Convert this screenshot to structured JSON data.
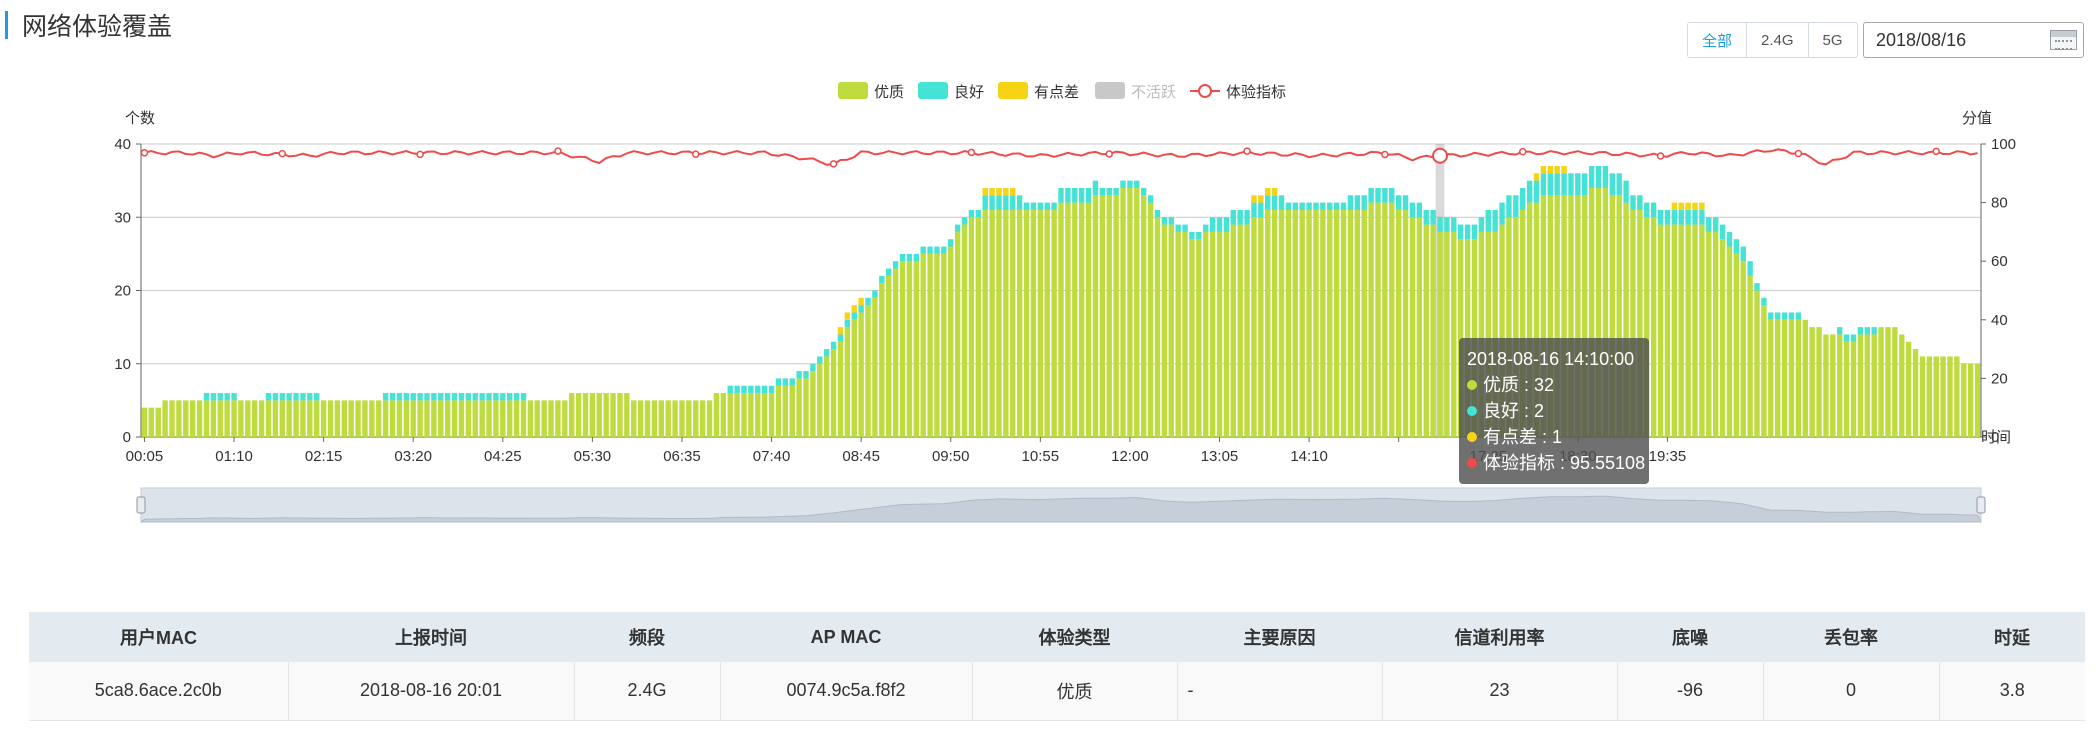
{
  "header": {
    "title": "网络体验覆盖"
  },
  "band_filter": {
    "options": [
      "全部",
      "2.4G",
      "5G"
    ],
    "selected": "全部"
  },
  "date_picker": {
    "value": "2018/08/16"
  },
  "colors": {
    "youzhi": "#bedc3e",
    "lianghao": "#45e2d6",
    "youdiancha": "#f7d316",
    "buhuoyue": "#c8c8c8",
    "tiyan": "#ee4b4b",
    "accent": "#1e9ce0"
  },
  "tooltip": {
    "time": "2018-08-16 14:10:00",
    "rows": [
      {
        "label": "优质 : 32",
        "color": "#bedc3e"
      },
      {
        "label": "良好 : 2",
        "color": "#45e2d6"
      },
      {
        "label": "有点差 : 1",
        "color": "#f7d316"
      },
      {
        "label": "体验指标 : 95.55108",
        "color": "#ee4b4b"
      }
    ]
  },
  "chart_data": {
    "type": "bar",
    "legend": [
      "优质",
      "良好",
      "有点差",
      "不活跃",
      "体验指标"
    ],
    "legend_position": "top-center",
    "y_left": {
      "label": "个数",
      "range": [
        0,
        40
      ],
      "ticks": [
        0,
        10,
        20,
        30,
        40
      ]
    },
    "y_right": {
      "label": "分值",
      "range": [
        0,
        100
      ],
      "ticks": [
        0,
        20,
        40,
        60,
        80,
        100
      ]
    },
    "x_label": "时间",
    "x_tick_labels": [
      "00:05",
      "01:10",
      "02:15",
      "03:20",
      "04:25",
      "05:30",
      "06:35",
      "07:40",
      "08:45",
      "09:50",
      "10:55",
      "12:00",
      "13:05",
      "14:10",
      "",
      "17:25",
      "18:30",
      "19:35"
    ],
    "grid": true,
    "anchors": {
      "youzhi": [
        [
          0,
          4
        ],
        [
          6,
          5
        ],
        [
          40,
          5
        ],
        [
          60,
          5
        ],
        [
          64,
          6
        ],
        [
          76,
          5
        ],
        [
          82,
          5
        ],
        [
          84,
          6
        ],
        [
          90,
          6
        ],
        [
          96,
          8
        ],
        [
          100,
          12
        ],
        [
          104,
          17
        ],
        [
          110,
          24
        ],
        [
          116,
          25
        ],
        [
          120,
          30
        ],
        [
          124,
          31
        ],
        [
          130,
          31
        ],
        [
          136,
          32
        ],
        [
          140,
          33
        ],
        [
          144,
          34
        ],
        [
          148,
          29
        ],
        [
          152,
          27
        ],
        [
          156,
          28
        ],
        [
          160,
          29
        ],
        [
          164,
          31
        ],
        [
          170,
          31
        ],
        [
          176,
          31
        ],
        [
          180,
          32
        ],
        [
          184,
          30
        ],
        [
          188,
          28
        ],
        [
          192,
          27
        ],
        [
          196,
          28
        ],
        [
          200,
          31
        ],
        [
          204,
          33
        ],
        [
          208,
          33
        ],
        [
          212,
          34
        ],
        [
          216,
          31
        ],
        [
          220,
          29
        ],
        [
          224,
          29
        ],
        [
          228,
          28
        ],
        [
          232,
          24
        ],
        [
          236,
          16
        ],
        [
          240,
          16
        ],
        [
          244,
          14
        ],
        [
          248,
          13
        ],
        [
          250,
          14
        ],
        [
          254,
          15
        ],
        [
          256,
          13
        ],
        [
          258,
          11
        ],
        [
          262,
          11
        ],
        [
          264,
          10
        ],
        [
          266,
          10
        ]
      ],
      "lianghao": [
        [
          0,
          0
        ],
        [
          8,
          0
        ],
        [
          10,
          1
        ],
        [
          16,
          0
        ],
        [
          20,
          1
        ],
        [
          30,
          0
        ],
        [
          40,
          1
        ],
        [
          70,
          0
        ],
        [
          80,
          0
        ],
        [
          90,
          1
        ],
        [
          96,
          1
        ],
        [
          100,
          1
        ],
        [
          110,
          1
        ],
        [
          116,
          1
        ],
        [
          120,
          1
        ],
        [
          124,
          2
        ],
        [
          130,
          1
        ],
        [
          136,
          2
        ],
        [
          140,
          1
        ],
        [
          150,
          1
        ],
        [
          160,
          2
        ],
        [
          170,
          1
        ],
        [
          180,
          2
        ],
        [
          190,
          2
        ],
        [
          200,
          3
        ],
        [
          210,
          3
        ],
        [
          220,
          2
        ],
        [
          230,
          2
        ],
        [
          236,
          1
        ],
        [
          244,
          0
        ],
        [
          248,
          1
        ],
        [
          254,
          0
        ],
        [
          266,
          0
        ]
      ],
      "youdiancha": [
        [
          0,
          0
        ],
        [
          100,
          0
        ],
        [
          102,
          1
        ],
        [
          106,
          0
        ],
        [
          120,
          0
        ],
        [
          124,
          1
        ],
        [
          128,
          0
        ],
        [
          160,
          0
        ],
        [
          162,
          1
        ],
        [
          166,
          0
        ],
        [
          200,
          0
        ],
        [
          204,
          1
        ],
        [
          208,
          0
        ],
        [
          220,
          0
        ],
        [
          224,
          1
        ],
        [
          228,
          0
        ],
        [
          266,
          0
        ]
      ],
      "tiyan": [
        [
          0,
          97
        ],
        [
          6,
          97
        ],
        [
          10,
          96
        ],
        [
          14,
          97
        ],
        [
          24,
          96
        ],
        [
          28,
          97
        ],
        [
          40,
          97
        ],
        [
          60,
          97
        ],
        [
          66,
          94
        ],
        [
          70,
          97
        ],
        [
          90,
          97
        ],
        [
          96,
          95
        ],
        [
          100,
          93
        ],
        [
          104,
          97
        ],
        [
          120,
          97
        ],
        [
          130,
          96
        ],
        [
          140,
          97
        ],
        [
          150,
          96
        ],
        [
          160,
          97
        ],
        [
          170,
          96
        ],
        [
          180,
          97
        ],
        [
          184,
          95
        ],
        [
          188,
          96
        ],
        [
          200,
          97
        ],
        [
          210,
          97
        ],
        [
          220,
          96
        ],
        [
          224,
          97
        ],
        [
          230,
          96
        ],
        [
          236,
          98
        ],
        [
          240,
          97
        ],
        [
          244,
          93
        ],
        [
          248,
          97
        ],
        [
          266,
          97
        ]
      ]
    },
    "tooltip_index": 188
  },
  "table": {
    "columns": [
      "用户MAC",
      "上报时间",
      "频段",
      "AP MAC",
      "体验类型",
      "主要原因",
      "信道利用率",
      "底噪",
      "丢包率",
      "时延"
    ],
    "rows": [
      [
        "5ca8.6ace.2c0b",
        "2018-08-16 20:01",
        "2.4G",
        "0074.9c5a.f8f2",
        "优质",
        "-",
        "23",
        "-96",
        "0",
        "3.8"
      ]
    ]
  }
}
